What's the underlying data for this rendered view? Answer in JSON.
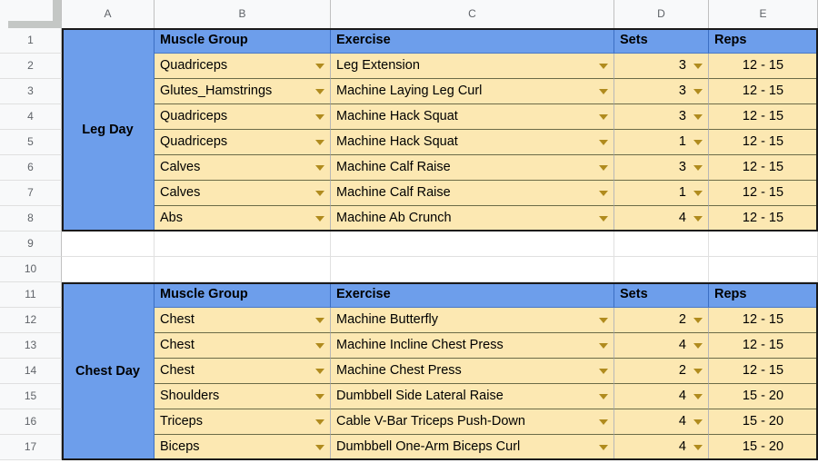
{
  "spreadsheet": {
    "column_headers": [
      "A",
      "B",
      "C",
      "D",
      "E"
    ],
    "row_headers": [
      "1",
      "2",
      "3",
      "4",
      "5",
      "6",
      "7",
      "8",
      "9",
      "10",
      "11",
      "12",
      "13",
      "14",
      "15",
      "16",
      "17"
    ],
    "colors": {
      "header_blue": "#6d9eeb",
      "data_cream": "#fce8b2",
      "gutter_gray": "#f8f9fa",
      "caret_gold": "#b08b1e"
    }
  },
  "tables": [
    {
      "day_label": "Leg Day",
      "header_row": 1,
      "columns": [
        "Muscle Group",
        "Exercise",
        "Sets",
        "Reps"
      ],
      "rows": [
        {
          "row": 2,
          "muscle_group": "Quadriceps",
          "exercise": "Leg Extension",
          "sets": "3",
          "reps": "12 - 15"
        },
        {
          "row": 3,
          "muscle_group": "Glutes_Hamstrings",
          "exercise": "Machine Laying Leg Curl",
          "sets": "3",
          "reps": "12 - 15"
        },
        {
          "row": 4,
          "muscle_group": "Quadriceps",
          "exercise": "Machine Hack Squat",
          "sets": "3",
          "reps": "12 - 15"
        },
        {
          "row": 5,
          "muscle_group": "Quadriceps",
          "exercise": "Machine Hack Squat",
          "sets": "1",
          "reps": "12 - 15"
        },
        {
          "row": 6,
          "muscle_group": "Calves",
          "exercise": "Machine Calf Raise",
          "sets": "3",
          "reps": "12 - 15"
        },
        {
          "row": 7,
          "muscle_group": "Calves",
          "exercise": "Machine Calf Raise",
          "sets": "1",
          "reps": "12 - 15"
        },
        {
          "row": 8,
          "muscle_group": "Abs",
          "exercise": "Machine Ab Crunch",
          "sets": "4",
          "reps": "12 - 15"
        }
      ]
    },
    {
      "day_label": "Chest Day",
      "header_row": 11,
      "columns": [
        "Muscle Group",
        "Exercise",
        "Sets",
        "Reps"
      ],
      "rows": [
        {
          "row": 12,
          "muscle_group": "Chest",
          "exercise": "Machine Butterfly",
          "sets": "2",
          "reps": "12 - 15"
        },
        {
          "row": 13,
          "muscle_group": "Chest",
          "exercise": "Machine Incline Chest Press",
          "sets": "4",
          "reps": "12 - 15"
        },
        {
          "row": 14,
          "muscle_group": "Chest",
          "exercise": "Machine Chest Press",
          "sets": "2",
          "reps": "12 - 15"
        },
        {
          "row": 15,
          "muscle_group": "Shoulders",
          "exercise": "Dumbbell Side Lateral Raise",
          "sets": "4",
          "reps": "15 - 20"
        },
        {
          "row": 16,
          "muscle_group": "Triceps",
          "exercise": "Cable V-Bar Triceps Push-Down",
          "sets": "4",
          "reps": "15 - 20"
        },
        {
          "row": 17,
          "muscle_group": "Biceps",
          "exercise": "Dumbbell One-Arm Biceps Curl",
          "sets": "4",
          "reps": "15 - 20"
        }
      ]
    }
  ],
  "empty_rows": [
    9,
    10
  ]
}
